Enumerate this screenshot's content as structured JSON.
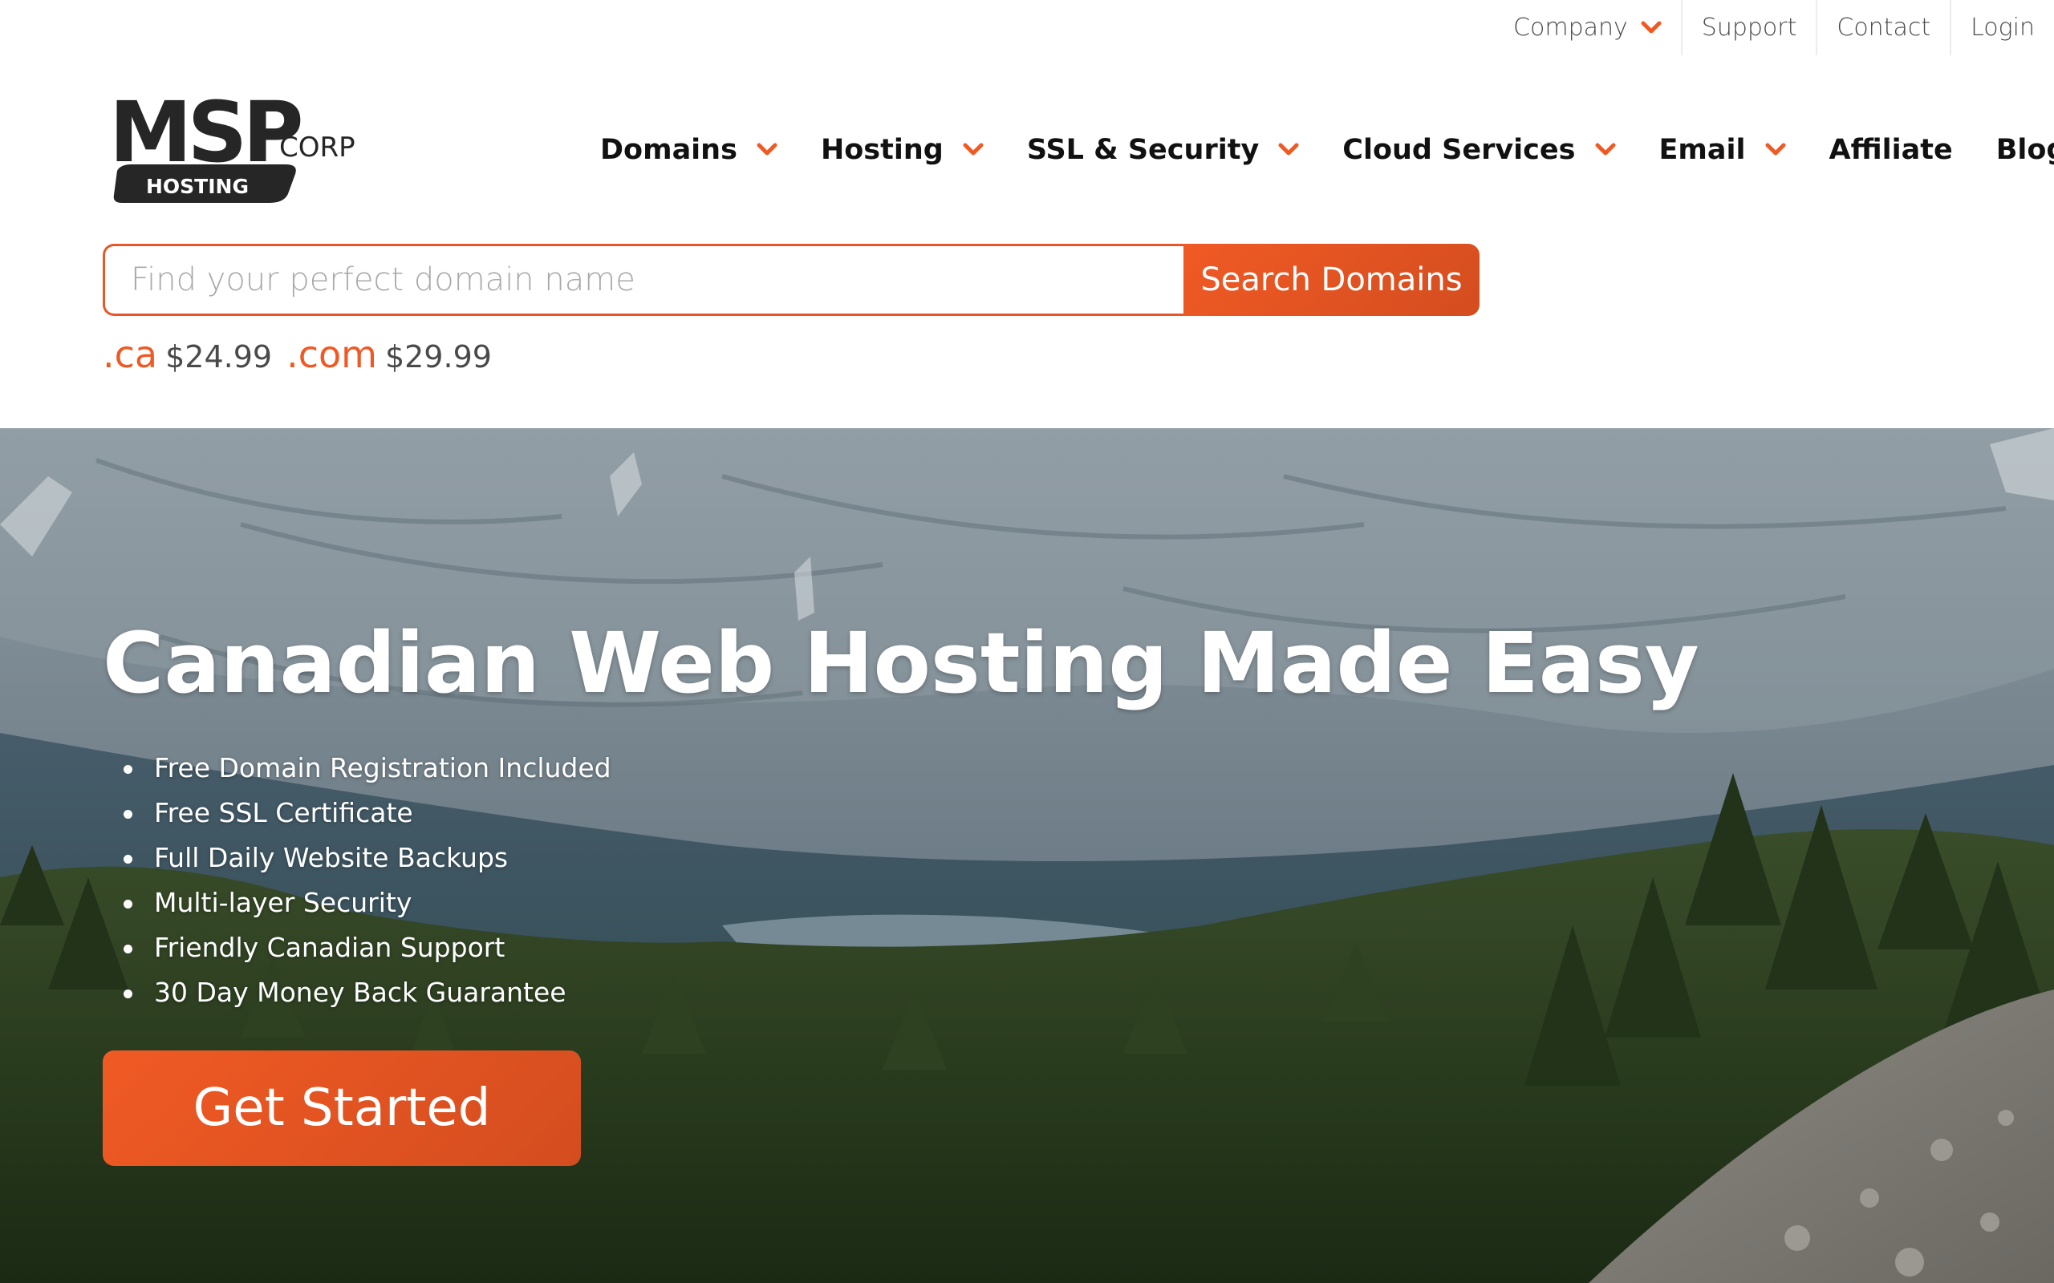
{
  "topbar": {
    "links": [
      {
        "label": "Company",
        "has_dropdown": true
      },
      {
        "label": "Support"
      },
      {
        "label": "Contact"
      },
      {
        "label": "Login"
      }
    ]
  },
  "logo": {
    "wordmark": "MSP",
    "corp": "CORP",
    "tagline": "HOSTING"
  },
  "nav": {
    "items": [
      {
        "label": "Domains",
        "has_dropdown": true
      },
      {
        "label": "Hosting",
        "has_dropdown": true
      },
      {
        "label": "SSL & Security",
        "has_dropdown": true
      },
      {
        "label": "Cloud Services",
        "has_dropdown": true
      },
      {
        "label": "Email",
        "has_dropdown": true
      },
      {
        "label": "Affiliate"
      },
      {
        "label": "Blog"
      }
    ]
  },
  "search": {
    "placeholder": "Find your perfect domain name",
    "value": "",
    "button_label": "Search Domains"
  },
  "prices": [
    {
      "tld": ".ca",
      "price": "$24.99"
    },
    {
      "tld": ".com",
      "price": "$29.99"
    }
  ],
  "hero": {
    "title": "Canadian Web Hosting Made Easy",
    "features": [
      "Free Domain Registration Included",
      "Free SSL Certificate",
      "Full Daily Website Backups",
      "Multi-layer Security",
      "Friendly Canadian Support",
      "30 Day Money Back Guarantee"
    ],
    "cta_label": "Get Started"
  },
  "colors": {
    "accent": "#ef5a24",
    "nav_text": "#111111",
    "muted_text": "#4a4a4a"
  },
  "icons": {
    "dropdown": "chevron-down-icon"
  }
}
